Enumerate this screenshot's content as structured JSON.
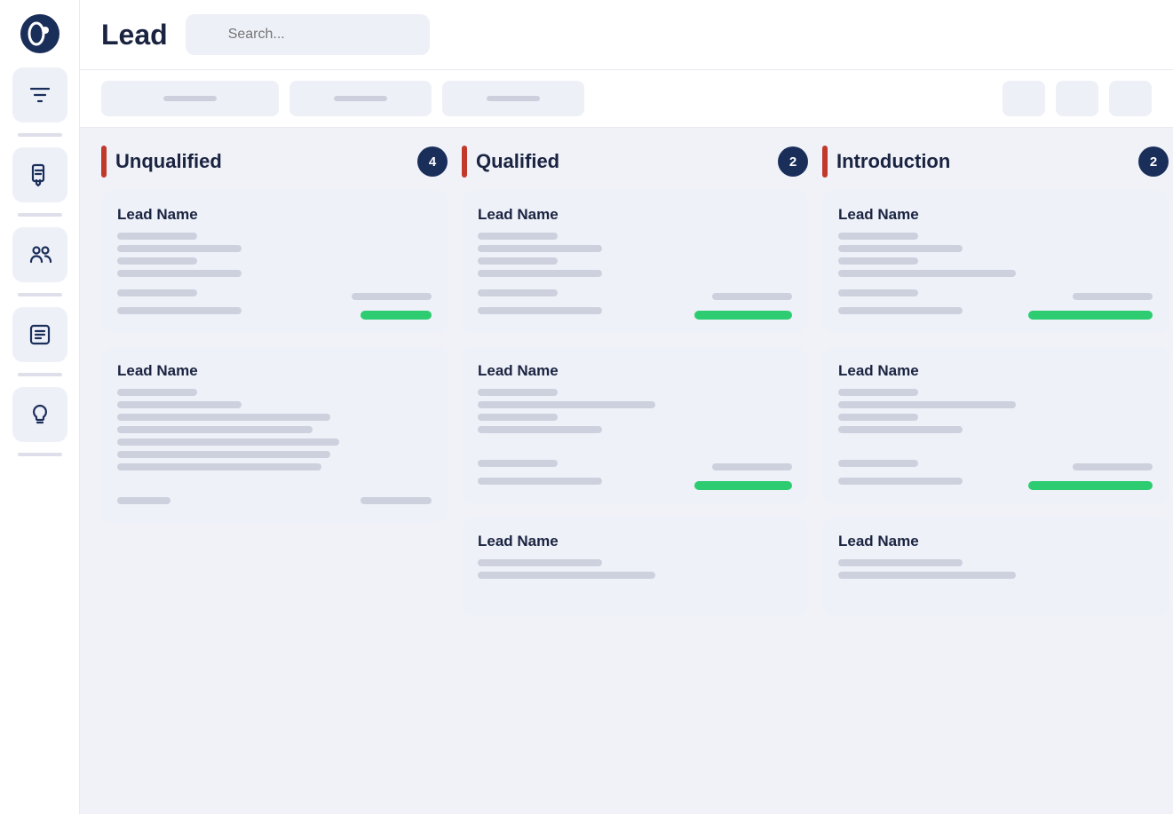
{
  "app": {
    "logo_icon": "circle-dot",
    "title": "Lead"
  },
  "search": {
    "placeholder": "Search..."
  },
  "sidebar": {
    "items": [
      {
        "id": "filter",
        "icon": "filter"
      },
      {
        "id": "document",
        "icon": "document-download"
      },
      {
        "id": "team",
        "icon": "team"
      },
      {
        "id": "reports",
        "icon": "reports"
      },
      {
        "id": "ideas",
        "icon": "lightbulb"
      }
    ]
  },
  "columns": [
    {
      "id": "unqualified",
      "title": "Unqualified",
      "count": 4,
      "cards": [
        {
          "id": "card-u1",
          "title": "Lead Name",
          "lines": [
            "short",
            "medium",
            "short",
            "medium",
            "short",
            "long"
          ],
          "footer_left": [
            "short",
            "medium"
          ],
          "footer_right": "green-sm",
          "show_footer": true
        },
        {
          "id": "card-u2",
          "title": "Lead Name",
          "lines": [
            "short",
            "medium",
            "short",
            "long",
            "medium",
            "long",
            "long",
            "long",
            "long"
          ],
          "footer_left": [],
          "footer_right": null,
          "show_footer": false
        }
      ]
    },
    {
      "id": "qualified",
      "title": "Qualified",
      "count": 2,
      "cards": [
        {
          "id": "card-q1",
          "title": "Lead Name",
          "lines": [
            "short",
            "medium",
            "short",
            "medium"
          ],
          "footer_left": [
            "short",
            "medium"
          ],
          "footer_right": "green-md",
          "show_footer": true
        },
        {
          "id": "card-q2",
          "title": "Lead Name",
          "lines": [
            "short",
            "medium",
            "short",
            "medium"
          ],
          "footer_left": [
            "short",
            "medium"
          ],
          "footer_right": "green-md",
          "show_footer": true
        },
        {
          "id": "card-q3",
          "title": "Lead Name",
          "lines": [
            "medium",
            "long"
          ],
          "footer_left": [],
          "footer_right": null,
          "show_footer": false
        }
      ]
    },
    {
      "id": "introduction",
      "title": "Introduction",
      "count": 2,
      "cards": [
        {
          "id": "card-i1",
          "title": "Lead Name",
          "lines": [
            "short",
            "medium",
            "short",
            "medium"
          ],
          "footer_left": [
            "short",
            "medium"
          ],
          "footer_right": "green-lg",
          "show_footer": true
        },
        {
          "id": "card-i2",
          "title": "Lead Name",
          "lines": [
            "short",
            "medium",
            "short",
            "medium"
          ],
          "footer_left": [
            "short",
            "medium"
          ],
          "footer_right": "green-lg",
          "show_footer": true
        },
        {
          "id": "card-i3",
          "title": "Lead Name",
          "lines": [
            "medium",
            "long"
          ],
          "footer_left": [],
          "footer_right": null,
          "show_footer": false
        }
      ]
    }
  ]
}
